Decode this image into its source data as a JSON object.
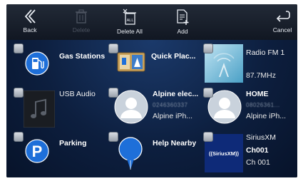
{
  "toolbar": {
    "back_label": "Back",
    "delete_label": "Delete",
    "delete_all_label": "Delete All",
    "add_label": "Add",
    "cancel_label": "Cancel"
  },
  "tiles": [
    {
      "title": "Gas Stations"
    },
    {
      "title": "Quick Plac..."
    },
    {
      "title": "Radio FM 1",
      "subtitle": "87.7MHz"
    },
    {
      "title": "USB Audio"
    },
    {
      "title": "Alpine elec...",
      "number": "0246360337",
      "subtitle": "Alpine iPh..."
    },
    {
      "title": "HOME",
      "number": "08026361...",
      "subtitle": "Alpine iPh..."
    },
    {
      "title": "Parking"
    },
    {
      "title": "Help Nearby"
    },
    {
      "title": "SiriusXM",
      "channel": "Ch001",
      "subtitle": "Ch 001",
      "logo_text": "((SiriusXM))"
    }
  ],
  "colors": {
    "background_top": "#1b3a6b",
    "icon_blue": "#1e6fd9",
    "checkbox": "#b9c0c8"
  }
}
